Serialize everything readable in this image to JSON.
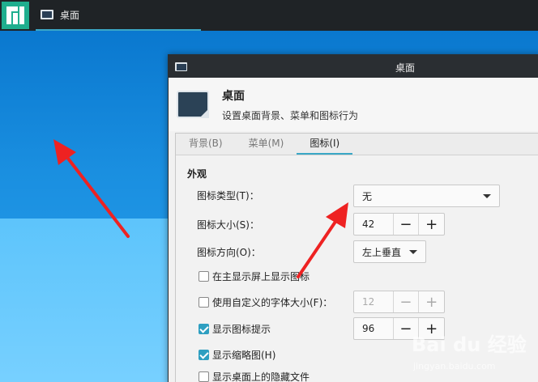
{
  "panel": {
    "taskbar_title": "桌面"
  },
  "dialog": {
    "title": "桌面",
    "header_title": "桌面",
    "header_subtitle": "设置桌面背景、菜单和图标行为",
    "tabs": [
      {
        "label": "背景(B)",
        "active": false
      },
      {
        "label": "菜单(M)",
        "active": false
      },
      {
        "label": "图标(I)",
        "active": true
      }
    ],
    "section_title": "外观",
    "icon_type": {
      "label": "图标类型(T)：",
      "value": "无"
    },
    "icon_size": {
      "label": "图标大小(S)：",
      "value": "42",
      "minus": "−",
      "plus": "+"
    },
    "icon_orientation": {
      "label": "图标方向(O)：",
      "value": "左上垂直"
    },
    "show_on_primary": {
      "label": "在主显示屏上显示图标",
      "checked": false
    },
    "custom_font_size": {
      "label": "使用自定义的字体大小(F)：",
      "checked": false,
      "value": "12",
      "minus": "−",
      "plus": "+"
    },
    "show_tooltips": {
      "label": "显示图标提示",
      "checked": true,
      "value": "96",
      "minus": "−",
      "plus": "+"
    },
    "show_thumbnails": {
      "label": "显示缩略图(H)",
      "checked": true
    },
    "show_hidden": {
      "label": "显示桌面上的隐藏文件",
      "checked": false
    }
  },
  "watermark": {
    "brand": "Bai du 经验",
    "url": "jingyan.baidu.com"
  },
  "colors": {
    "accent": "#3aa7c6",
    "arrow": "#ee2222",
    "panel_bg": "#1f2326",
    "checkbox_checked": "#2e9fc1"
  }
}
